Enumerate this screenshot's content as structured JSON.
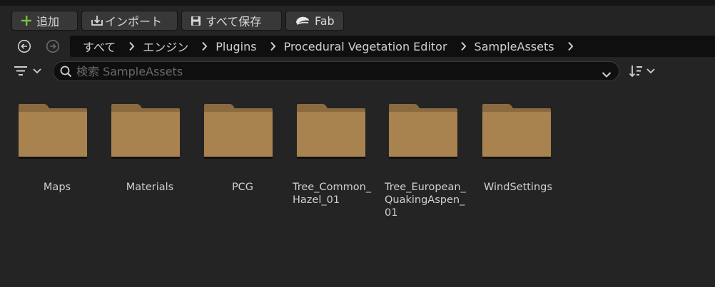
{
  "toolbar": {
    "add_label": "追加",
    "import_label": "インポート",
    "save_all_label": "すべて保存",
    "fab_label": "Fab",
    "add_icon": "plus-icon",
    "import_icon": "import-icon",
    "save_icon": "save-icon",
    "fab_icon": "fab-icon",
    "accent_green": "#7bc043"
  },
  "nav": {
    "back_icon": "back-arrow-icon",
    "forward_icon": "forward-arrow-icon",
    "breadcrumbs": [
      "すべて",
      "エンジン",
      "Plugins",
      "Procedural Vegetation Editor",
      "SampleAssets"
    ]
  },
  "filters": {
    "filter_icon": "filter-icon",
    "search_placeholder": "検索 SampleAssets",
    "sort_icon": "sort-icon"
  },
  "folders": [
    {
      "label": "Maps"
    },
    {
      "label": "Materials"
    },
    {
      "label": "PCG"
    },
    {
      "label_lines": [
        "Tree_Common_",
        "Hazel_01"
      ]
    },
    {
      "label_lines": [
        "Tree_European_",
        "QuakingAspen_",
        "01"
      ]
    },
    {
      "label": "WindSettings"
    }
  ],
  "colors": {
    "folder_fill": "#a9834f",
    "folder_dark": "#8a6a3e",
    "background": "#242424"
  }
}
